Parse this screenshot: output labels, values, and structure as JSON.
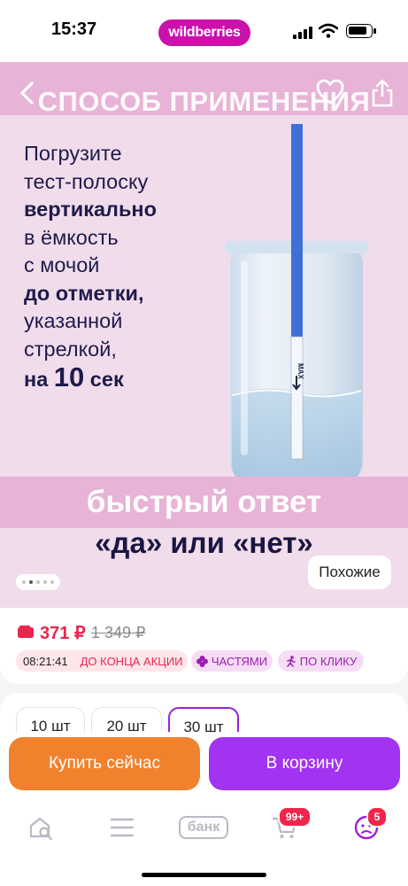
{
  "status_bar": {
    "time": "15:37",
    "brand": "wildberries"
  },
  "hero": {
    "band_title": "СПОСОБ ПРИМЕНЕНИЯ",
    "instruction": {
      "l1": "Погрузите",
      "l2": "тест-полоску",
      "l3": "вертикально",
      "l4": "в ёмкость",
      "l5": "с мочой",
      "l6": "до отметки,",
      "l7": "указанной",
      "l8": "стрелкой,",
      "l9a": "на ",
      "l9b": "10",
      "l9c": " сек"
    },
    "strip_mark": "MAX",
    "answer_line1": "быстрый ответ",
    "answer_line2": "«да» или «нет»",
    "similar_label": "Похожие",
    "slide_count": 5,
    "active_slide": 2
  },
  "price": {
    "current": "371 ₽",
    "old": "1 349 ₽",
    "timer": "08:21:41",
    "timer_label": "ДО КОНЦА АКЦИИ",
    "installments_label": "ЧАСТЯМИ",
    "one_click_label": "ПО КЛИКУ"
  },
  "variants": [
    {
      "label": "10 шт",
      "active": false
    },
    {
      "label": "20 шт",
      "active": false
    },
    {
      "label": "30 шт",
      "active": true
    }
  ],
  "actions": {
    "buy_now": "Купить сейчас",
    "add_to_cart": "В корзину"
  },
  "nav": {
    "bank_label": "банк",
    "cart_badge": "99+",
    "profile_badge": "5"
  },
  "colors": {
    "brand": "#cb11ab",
    "band": "#e7b3d6",
    "hero_bg": "#f1dcec",
    "price": "#e8264e",
    "buy_now": "#f0822e",
    "add_to_cart": "#a233f0"
  }
}
